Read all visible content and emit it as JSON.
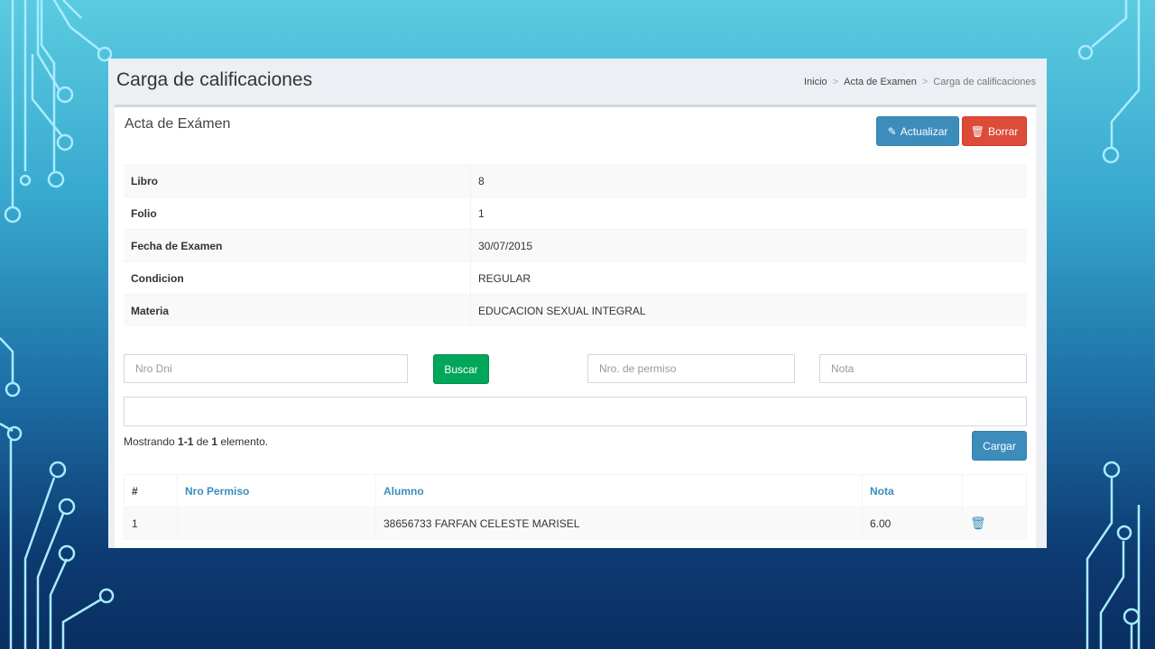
{
  "header": {
    "title": "Carga de calificaciones",
    "breadcrumb": [
      "Inicio",
      "Acta de Examen",
      "Carga de calificaciones"
    ],
    "breadcrumb_sep": ">"
  },
  "box": {
    "title": "Acta de Exámen",
    "update_label": "Actualizar",
    "delete_label": "Borrar"
  },
  "details": [
    {
      "label": "Libro",
      "value": "8"
    },
    {
      "label": "Folio",
      "value": "1"
    },
    {
      "label": "Fecha de Examen",
      "value": "30/07/2015"
    },
    {
      "label": "Condicion",
      "value": "REGULAR"
    },
    {
      "label": "Materia",
      "value": "EDUCACION SEXUAL INTEGRAL"
    }
  ],
  "form": {
    "dni_placeholder": "Nro Dni",
    "search_label": "Buscar",
    "permit_placeholder": "Nro. de permiso",
    "grade_placeholder": "Nota",
    "student_value": "",
    "load_label": "Cargar"
  },
  "summary": {
    "prefix": "Mostrando ",
    "range": "1-1",
    "middle": " de ",
    "total": "1",
    "suffix": " elemento."
  },
  "results": {
    "columns": [
      "#",
      "Nro Permiso",
      "Alumno",
      "Nota",
      ""
    ],
    "rows": [
      {
        "index": "1",
        "permit": "",
        "student": "38656733 FARFAN CELESTE MARISEL",
        "grade": "6.00"
      }
    ]
  },
  "icons": {
    "pencil": "pencil-icon",
    "trash": "trash-icon"
  },
  "colors": {
    "primary": "#3c8dbc",
    "danger": "#dd4b39",
    "success": "#00a65a"
  }
}
